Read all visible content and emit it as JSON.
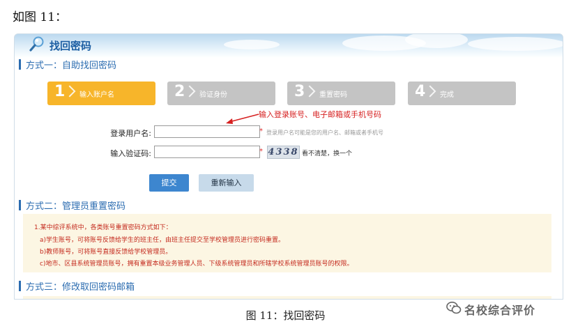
{
  "doc_heading": "如图 11：",
  "page": {
    "title": "找回密码",
    "method1_title": "方式一：自助找回密码",
    "method2_title": "方式二：管理员重置密码",
    "method3_title": "方式三：修改取回密码邮箱"
  },
  "steps": [
    {
      "num": "1",
      "label": "输入账户名",
      "active": true
    },
    {
      "num": "2",
      "label": "验证身份",
      "active": false
    },
    {
      "num": "3",
      "label": "重置密码",
      "active": false
    },
    {
      "num": "4",
      "label": "完成",
      "active": false
    }
  ],
  "annotation": "输入登录账号、电子邮箱或手机号码",
  "form": {
    "username_label": "登录用户名:",
    "username_value": "",
    "username_required": "*",
    "username_hint": "登录用户名可能是您的用户名、邮箱或者手机号",
    "captcha_label": "输入验证码:",
    "captcha_value": "",
    "captcha_required": "*",
    "captcha_code": "4338",
    "captcha_refresh": "看不清楚，换一个"
  },
  "buttons": {
    "submit": "提交",
    "reset": "重新输入"
  },
  "admin_info": {
    "line1": "1.某中综评系统中，各类账号重置密码方式如下：",
    "line2": "a)学生账号，可将账号反馈给学生的班主任，由班主任提交至学校管理员进行密码重置。",
    "line3": "b)教师账号，可将账号直接反馈给学校管理员。",
    "line4": "c)地市、区县系统管理员账号，拥有重置本级业务管理人员、下级系统管理员和所辖学校系统管理员账号的权限。"
  },
  "caption": "图 11：找回密码",
  "watermark": "名校综合评价",
  "colors": {
    "accent_blue": "#2b6cb0",
    "step_active": "#f7b52a",
    "step_inactive": "#c4c4c4",
    "required_red": "#e03030",
    "admin_text": "#c42a1e"
  }
}
